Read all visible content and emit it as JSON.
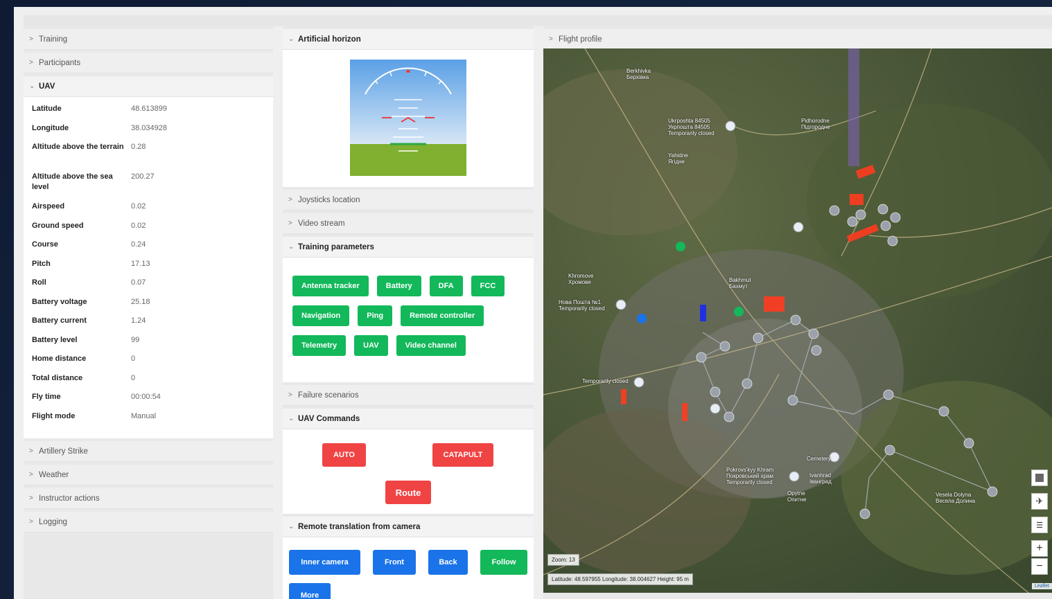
{
  "left": {
    "top_sections": [
      {
        "label": "Training",
        "open": false
      },
      {
        "label": "Participants",
        "open": false
      },
      {
        "label": "UAV",
        "open": true
      }
    ],
    "uav_fields": [
      {
        "label": "Latitude",
        "value": "48.613899"
      },
      {
        "label": "Longitude",
        "value": "38.034928"
      },
      {
        "label": "Altitude above the terrain",
        "value": "0.28"
      },
      {
        "label": "Altitude above the sea level",
        "value": "200.27"
      },
      {
        "label": "Airspeed",
        "value": "0.02"
      },
      {
        "label": "Ground speed",
        "value": "0.02"
      },
      {
        "label": "Course",
        "value": "0.24"
      },
      {
        "label": "Pitch",
        "value": "17.13"
      },
      {
        "label": "Roll",
        "value": "0.07"
      },
      {
        "label": "Battery voltage",
        "value": "25.18"
      },
      {
        "label": "Battery current",
        "value": "1.24"
      },
      {
        "label": "Battery level",
        "value": "99"
      },
      {
        "label": "Home distance",
        "value": "0"
      },
      {
        "label": "Total distance",
        "value": "0"
      },
      {
        "label": "Fly time",
        "value": "00:00:54"
      },
      {
        "label": "Flight mode",
        "value": "Manual"
      }
    ],
    "bottom_sections": [
      {
        "label": "Artillery Strike"
      },
      {
        "label": "Weather"
      },
      {
        "label": "Instructor actions"
      },
      {
        "label": "Logging"
      }
    ]
  },
  "mid": {
    "artificial_horizon": "Artificial horizon",
    "joysticks": "Joysticks location",
    "video_stream": "Video stream",
    "training_parameters": {
      "title": "Training parameters",
      "rows": [
        [
          "Antenna tracker",
          "Battery",
          "DFA",
          "FCC"
        ],
        [
          "Navigation",
          "Ping",
          "Remote controller"
        ],
        [
          "Telemetry",
          "UAV",
          "Video channel"
        ]
      ]
    },
    "failure_scenarios": "Failure scenarios",
    "uav_commands": {
      "title": "UAV Commands",
      "auto": "AUTO",
      "catapult": "CATAPULT",
      "route": "Route"
    },
    "remote_translation": {
      "title": "Remote translation from camera",
      "inner_camera": "Inner camera",
      "front": "Front",
      "back": "Back",
      "follow": "Follow",
      "more": "More"
    }
  },
  "right": {
    "flight_profile": "Flight profile",
    "zoom": "Zoom: 13",
    "coords": "Latitude: 48.597955 Longitude: 38.004627 Height: 95 m",
    "attribution": "Leaflet",
    "labels": {
      "berkhivka": "Berkhivka",
      "berkhivka_uk": "Берхівка",
      "ukrposhta": "Ukrposhta 84505",
      "ukrposhta_uk": "Укрпошта 84505",
      "temp_closed": "Temporarily closed",
      "pidhorodne": "Pidhorodne",
      "pidhorodne_uk": "Підгородне",
      "yahidne": "Yahidne",
      "yahidne_uk": "Ягідне",
      "khromove": "Khromove",
      "khromove_uk": "Хромове",
      "nova_poshta": "Нова Пошта №1",
      "nova_temp": "Temporarily closed",
      "bakhmut": "Bakhmut",
      "bakhmut_uk": "Бахмут",
      "temp_closed2": "Temporarily closed",
      "cemetery": "Cemetery",
      "pokrovs": "Pokrovs'kyy Khram",
      "pokrovs_uk": "Покровський храм",
      "pokrovs_temp": "Temporarily closed",
      "ivanhrad": "Ivanhrad",
      "ivanhrad_uk": "Іванград",
      "opytne": "Opytne",
      "opytne_uk": "Опитне",
      "vesela": "Vesela Dolyna",
      "vesela_uk": "Весела Долина"
    }
  }
}
